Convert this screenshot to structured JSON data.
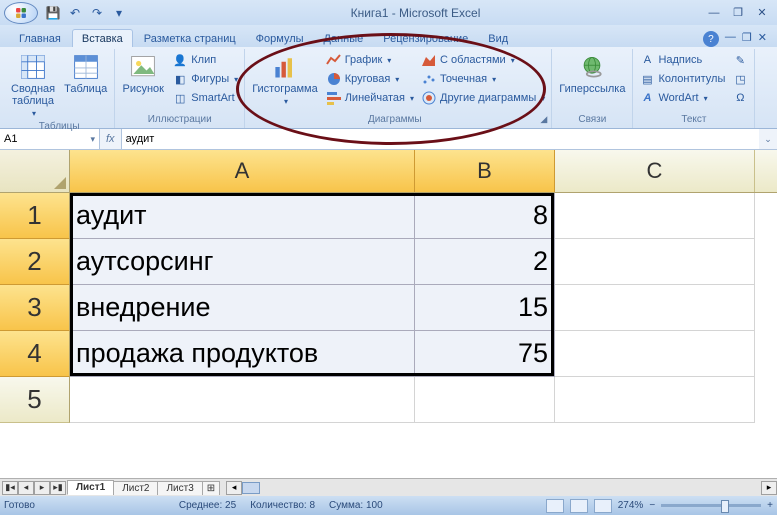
{
  "title": "Книга1 - Microsoft Excel",
  "tabs": {
    "home": "Главная",
    "insert": "Вставка",
    "pagelayout": "Разметка страниц",
    "formulas": "Формулы",
    "data": "Данные",
    "review": "Рецензирование",
    "view": "Вид"
  },
  "ribbon": {
    "tables": {
      "pivot": "Сводная\nтаблица",
      "table": "Таблица",
      "label": "Таблицы"
    },
    "illustrations": {
      "picture": "Рисунок",
      "clip": "Клип",
      "shapes": "Фигуры",
      "smartart": "SmartArt",
      "label": "Иллюстрации"
    },
    "charts": {
      "column": "Гистограмма",
      "line": "График",
      "pie": "Круговая",
      "bar": "Линейчатая",
      "area": "С областями",
      "scatter": "Точечная",
      "other": "Другие диаграммы",
      "label": "Диаграммы"
    },
    "links": {
      "hyperlink": "Гиперссылка",
      "label": "Связи"
    },
    "text": {
      "textbox": "Надпись",
      "headerfooter": "Колонтитулы",
      "wordart": "WordArt",
      "label": "Текст"
    }
  },
  "namebox": "A1",
  "formula": "аудит",
  "columns": {
    "A": "A",
    "B": "B",
    "C": "C"
  },
  "widths": {
    "A": 345,
    "B": 140,
    "C": 200
  },
  "rows": [
    {
      "n": "1",
      "a": "аудит",
      "b": "8"
    },
    {
      "n": "2",
      "a": "аутсорсинг",
      "b": "2"
    },
    {
      "n": "3",
      "a": "внедрение",
      "b": "15"
    },
    {
      "n": "4",
      "a": "продажа продуктов",
      "b": "75"
    },
    {
      "n": "5",
      "a": "",
      "b": ""
    }
  ],
  "sheets": {
    "s1": "Лист1",
    "s2": "Лист2",
    "s3": "Лист3"
  },
  "status": {
    "ready": "Готово",
    "avg": "Среднее: 25",
    "count": "Количество: 8",
    "sum": "Сумма: 100",
    "zoom": "274%"
  }
}
